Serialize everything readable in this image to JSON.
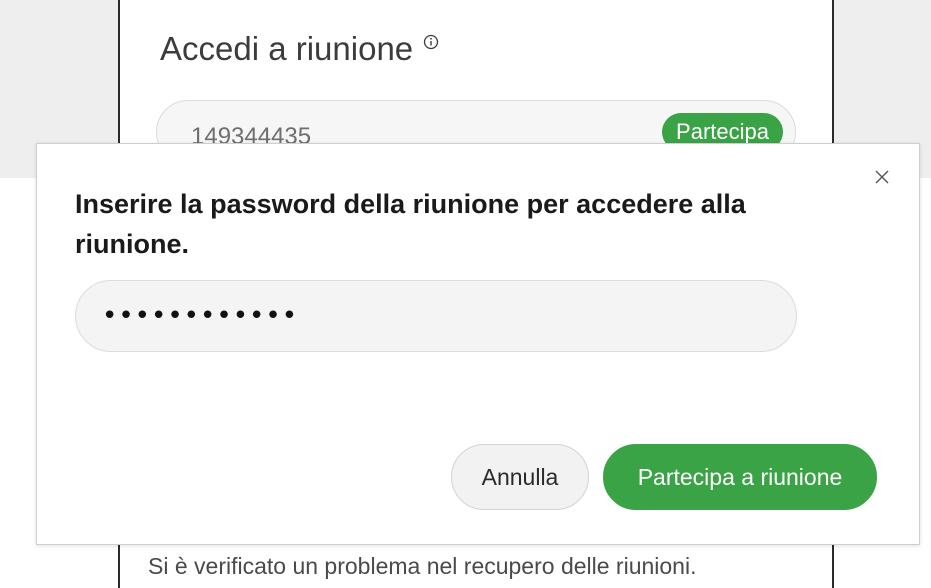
{
  "background": {
    "title": "Accedi a riunione",
    "title_icon": "info-icon",
    "meeting_number": "149344435",
    "join_label": "Partecipa",
    "error_message": "Si è verificato un problema nel recupero delle riunioni."
  },
  "dialog": {
    "title": "Inserire la password della riunione per accedere alla riunione.",
    "close_icon": "close-icon",
    "password_value": "••••••••••••",
    "cancel_label": "Annulla",
    "join_label": "Partecipa a riunione"
  },
  "colors": {
    "accent_green": "#3aa346",
    "border": "#dcdcdc",
    "field_bg": "#f4f4f4"
  }
}
